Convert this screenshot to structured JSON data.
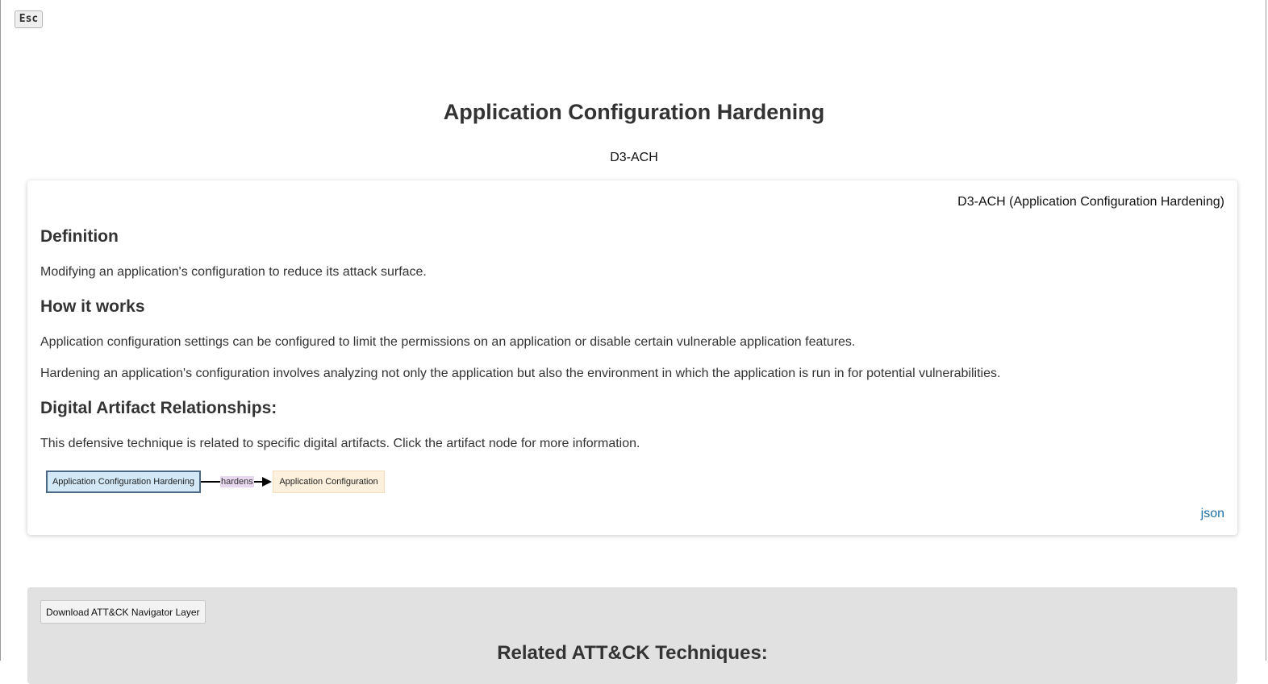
{
  "controls": {
    "esc_label": "Esc"
  },
  "header": {
    "title": "Application Configuration Hardening",
    "id": "D3-ACH"
  },
  "card": {
    "id_label": "D3-ACH (Application Configuration Hardening)",
    "definition": {
      "heading": "Definition",
      "text": "Modifying an application's configuration to reduce its attack surface."
    },
    "how_it_works": {
      "heading": "How it works",
      "paragraphs": [
        "Application configuration settings can be configured to limit the permissions on an application or disable certain vulnerable application features.",
        "Hardening an application's configuration involves analyzing not only the application but also the environment in which the application is run in for potential vulnerabilities."
      ]
    },
    "artifacts": {
      "heading": "Digital Artifact Relationships:",
      "text": "This defensive technique is related to specific digital artifacts. Click the artifact node for more information.",
      "graph": {
        "source": "Application Configuration Hardening",
        "relation": "hardens",
        "target": "Application Configuration",
        "colors": {
          "source_fill": "#d2e8f7",
          "source_border": "#4c6a86",
          "relation_fill": "#e8d7ef",
          "target_fill": "#fdf0dc"
        }
      }
    },
    "json_link": "json"
  },
  "related": {
    "download_label": "Download ATT&CK Navigator Layer",
    "title": "Related ATT&CK Techniques:"
  }
}
